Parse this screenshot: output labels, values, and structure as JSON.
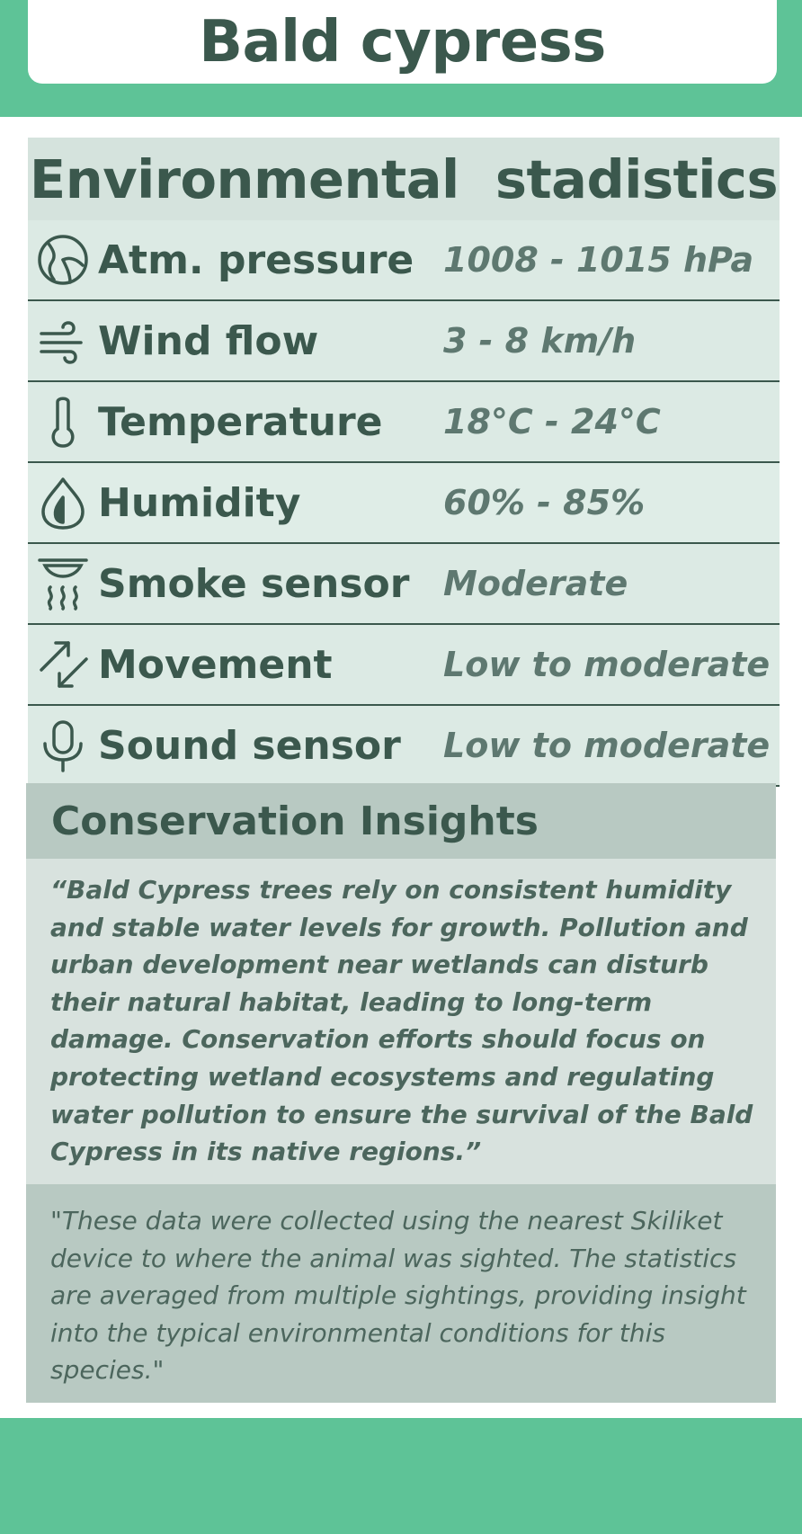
{
  "header": {
    "title": "Bald cypress"
  },
  "stats": {
    "heading": "Environmental  stadistics",
    "rows": [
      {
        "icon": "gauge-icon",
        "label": "Atm. pressure",
        "value": "1008 - 1015 hPa"
      },
      {
        "icon": "wind-icon",
        "label": "Wind flow",
        "value": "3 - 8 km/h"
      },
      {
        "icon": "thermometer-icon",
        "label": "Temperature",
        "value": "18°C - 24°C"
      },
      {
        "icon": "droplet-icon",
        "label": "Humidity",
        "value": "60% - 85%"
      },
      {
        "icon": "smoke-detector-icon",
        "label": "Smoke sensor",
        "value": "Moderate"
      },
      {
        "icon": "movement-arrows-icon",
        "label": "Movement",
        "value": "Low to moderate"
      },
      {
        "icon": "microphone-icon",
        "label": "Sound sensor",
        "value": "Low to moderate"
      }
    ]
  },
  "insights": {
    "heading": "Conservation Insights",
    "text": "“Bald Cypress trees rely on consistent humidity and stable water levels for growth. Pollution and urban development near wetlands can disturb their natural habitat, leading to long-term damage. Conservation efforts should focus on protecting wetland ecosystems and regulating water pollution to ensure the survival of the Bald Cypress in its native regions.”"
  },
  "note": {
    "text": "\"These data were collected using the nearest Skiliket device to where the animal was sighted. The statistics are averaged from multiple sightings, providing insight into the typical environmental conditions for this species.\""
  },
  "colors": {
    "brand_green": "#5ec397",
    "text_dark": "#3b584d",
    "value_text": "#5e7870",
    "panel_light": "#dceae4",
    "panel_mid": "#b8c9c2"
  }
}
